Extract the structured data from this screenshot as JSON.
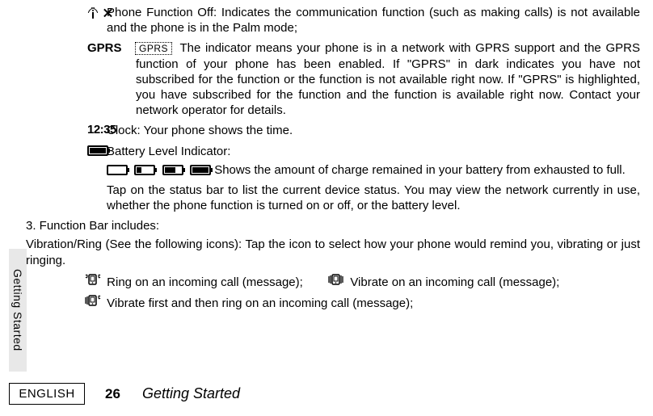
{
  "entries": {
    "phone_off": {
      "icon": "antenna-x-icon",
      "text": "Phone Function Off: Indicates the communication function (such as making calls) is not available and the phone is in the Palm mode;"
    },
    "gprs": {
      "label": "GPRS",
      "boxed": "GPRS",
      "text": "The indicator means your phone is in a network with GPRS support and the GPRS function of your phone has been enabled. If \"GPRS\" in dark indicates you have not subscribed for the function or the function is not available right now. If \"GPRS\" is highlighted, you have subscribed for the function and the function is available right now. Contact your network operator for details."
    },
    "clock": {
      "icon_text": "12:35",
      "text": "Clock: Your phone shows the time."
    },
    "battery": {
      "label": "Battery Level Indicator:",
      "desc": "Shows the amount of charge remained in your battery from exhausted to full.",
      "tap_text": "Tap on the status bar to list the current device status. You may view the network currently in use, whether the phone function is turned on or off, or the battery level."
    }
  },
  "section3_heading": "3. Function Bar includes:",
  "vibration_intro": "Vibration/Ring (See the following icons): Tap the icon to select how your phone would remind you, vibrating or just ringing.",
  "ring_options": {
    "ring": "Ring on an incoming call (message);",
    "vibrate": "Vibrate on an incoming call (message);",
    "vibrate_then_ring": "Vibrate first and then ring on an incoming call (message);"
  },
  "sidetab": "Getting Started",
  "footer": {
    "language": "ENGLISH",
    "page_number": "26",
    "title": "Getting Started"
  }
}
